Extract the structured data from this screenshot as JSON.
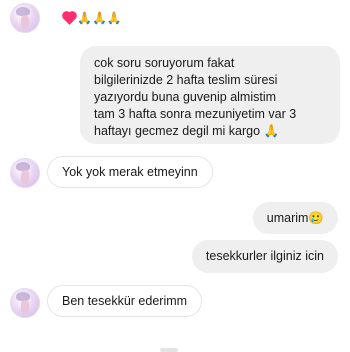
{
  "messages": {
    "m1": {
      "text": "❤️🙏🙏🙏",
      "emoji_prays": "🙏🙏🙏"
    },
    "m2": {
      "lines": [
        "cok soru soruyorum fakat",
        "bilgilerinizde 2 hafta teslim süresi",
        "yazıyordu buna guvenip almistim",
        "tam 3 hafta sonra mezuniyetim var 3",
        "haftayı gecmez degil mi kargo 🙏"
      ]
    },
    "m3": {
      "text": "Yok yok merak etmeyinn"
    },
    "m4": {
      "text": "umarim🥲"
    },
    "m5": {
      "text": "tesekkurler ilginiz icin"
    },
    "m6": {
      "text": "Ben tesekkür ederimm"
    }
  },
  "colors": {
    "incoming_border": "#e6e6e6",
    "outgoing_bg": "#efefef",
    "heart": "#ff2f6d"
  }
}
